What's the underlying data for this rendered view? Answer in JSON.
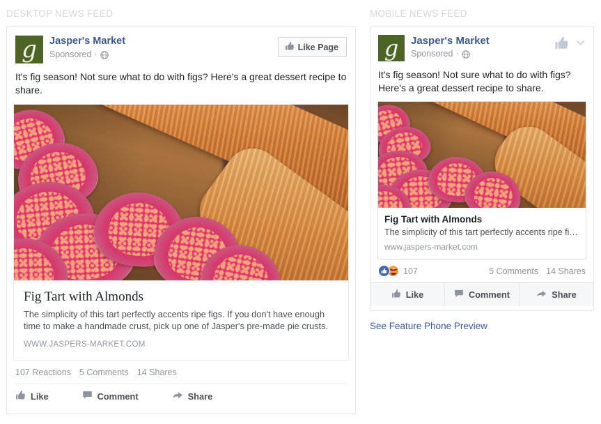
{
  "columns": {
    "desktop_label": "DESKTOP NEWS FEED",
    "mobile_label": "MOBILE NEWS FEED"
  },
  "brand": {
    "page_name": "Jasper's Market",
    "avatar_letter": "g",
    "avatar_color": "#4d6427",
    "link_color": "#3b5998",
    "meta_color": "#90949c"
  },
  "desktop": {
    "sponsored_label": "Sponsored",
    "privacy_icon": "globe-icon",
    "separator": "·",
    "like_page_label": "Like Page",
    "post_text": "It's fig season! Not sure what to do with figs? Here's a great dessert recipe to share.",
    "photo_alt": "fig-tart-photo",
    "link": {
      "title": "Fig Tart with Almonds",
      "description": "The simplicity of this tart perfectly accents ripe figs. If you don't have enough time to make a handmade crust, pick up one of Jasper's pre-made pie crusts.",
      "url": "WWW.JASPERS-MARKET.COM"
    },
    "stats": {
      "reactions": "107 Reactions",
      "comments": "5 Comments",
      "shares": "14 Shares"
    },
    "actions": {
      "like": "Like",
      "comment": "Comment",
      "share": "Share"
    }
  },
  "mobile": {
    "sponsored_label": "Sponsored",
    "privacy_icon": "globe-icon",
    "separator": "·",
    "post_text": "It's fig season! Not sure what to do with figs? Here's a great dessert recipe to share.",
    "photo_alt": "fig-tart-photo",
    "header_icons": [
      "thumbs-up-icon",
      "chevron-down-icon"
    ],
    "link": {
      "title": "Fig Tart with Almonds",
      "description": "The simplicity of this tart perfectly accents ripe fi…",
      "url": "www.jaspers-market.com"
    },
    "stats": {
      "reaction_icons": [
        "like-reaction-icon",
        "angry-reaction-icon"
      ],
      "reaction_count": "107",
      "comments": "5 Comments",
      "shares": "14 Shares"
    },
    "actions": {
      "like": "Like",
      "comment": "Comment",
      "share": "Share"
    },
    "feature_phone_link": "See Feature Phone Preview"
  }
}
